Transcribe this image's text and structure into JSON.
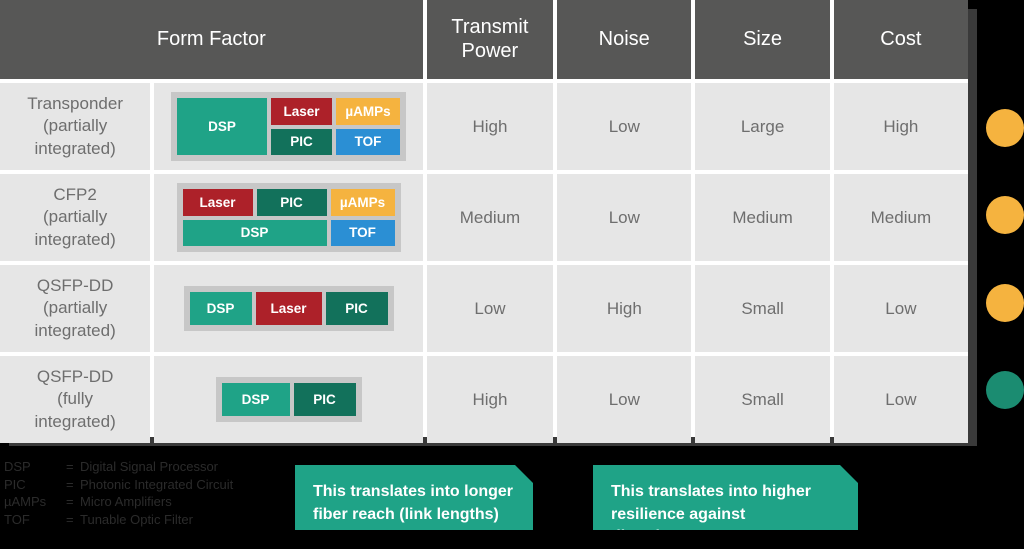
{
  "colors": {
    "header_bg": "#575756",
    "cell_bg": "#e6e6e6",
    "text_gray": "#6e6e6e",
    "dsp": "#1fa387",
    "pic": "#12715b",
    "laser": "#ad2129",
    "uamps": "#f5b33f",
    "tof": "#2b8fd4",
    "package": "#c7c7c7",
    "dot_amber": "#f5b33f",
    "dot_teal": "#1b8c71",
    "callout_bg": "#1fa387"
  },
  "table": {
    "headers": {
      "form_factor": "Form Factor",
      "transmit_power": "Transmit\nPower",
      "transmit_power_line1": "Transmit",
      "transmit_power_line2": "Power",
      "noise": "Noise",
      "size": "Size",
      "cost": "Cost"
    },
    "rows": [
      {
        "name_line1": "Transponder",
        "name_line2": "(partially",
        "name_line3": "integrated)",
        "transmit_power": "High",
        "noise": "Low",
        "size": "Large",
        "cost": "High",
        "blocks": [
          "DSP",
          "Laser",
          "µAMPs",
          "PIC",
          "TOF"
        ]
      },
      {
        "name_line1": "CFP2",
        "name_line2": "(partially",
        "name_line3": "integrated)",
        "transmit_power": "Medium",
        "noise": "Low",
        "size": "Medium",
        "cost": "Medium",
        "blocks": [
          "Laser",
          "PIC",
          "µAMPs",
          "DSP",
          "TOF"
        ]
      },
      {
        "name_line1": "QSFP-DD",
        "name_line2": "(partially",
        "name_line3": "integrated)",
        "transmit_power": "Low",
        "noise": "High",
        "size": "Small",
        "cost": "Low",
        "blocks": [
          "DSP",
          "Laser",
          "PIC"
        ]
      },
      {
        "name_line1": "QSFP-DD",
        "name_line2": "(fully",
        "name_line3": "integrated)",
        "transmit_power": "High",
        "noise": "Low",
        "size": "Small",
        "cost": "Low",
        "blocks": [
          "DSP",
          "PIC"
        ]
      }
    ]
  },
  "blocks": {
    "dsp": "DSP",
    "pic": "PIC",
    "laser": "Laser",
    "uamps": "µAMPs",
    "tof": "TOF"
  },
  "indicators": [
    {
      "label": "row-1-indicator",
      "color": "#f5b33f"
    },
    {
      "label": "row-2-indicator",
      "color": "#f5b33f"
    },
    {
      "label": "row-3-indicator",
      "color": "#f5b33f"
    },
    {
      "label": "row-4-indicator",
      "color": "#1b8c71"
    }
  ],
  "legend": [
    {
      "abbr": "DSP",
      "eq": "=",
      "text": "Digital Signal Processor"
    },
    {
      "abbr": "PIC",
      "eq": "=",
      "text": "Photonic Integrated Circuit"
    },
    {
      "abbr": "µAMPs",
      "eq": "=",
      "text": "Micro Amplifiers"
    },
    {
      "abbr": "TOF",
      "eq": "=",
      "text": "Tunable Optic Filter"
    }
  ],
  "callouts": [
    {
      "line1": "This translates into longer",
      "line2": "fiber reach (link lengths)"
    },
    {
      "line1": "This translates into higher",
      "line2": "resilience against disturbances"
    }
  ]
}
